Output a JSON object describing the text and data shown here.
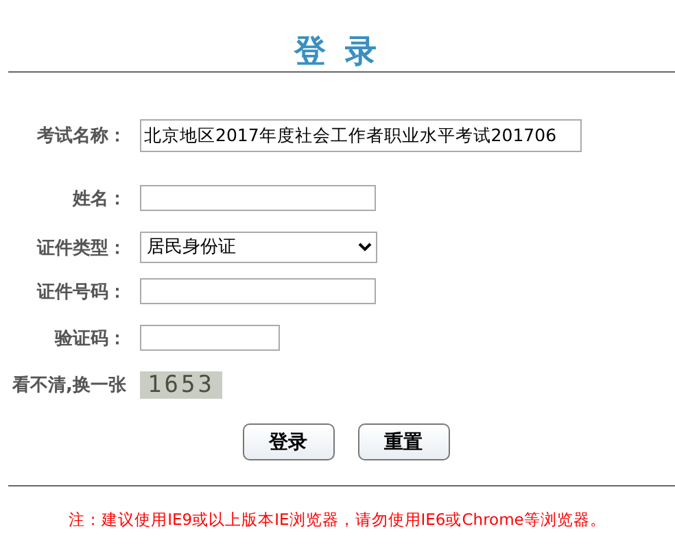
{
  "title": "登 录",
  "fields": [
    {
      "label": "考试名称：",
      "kind": "wide",
      "value": "北京地区2017年度社会工作者职业水平考试201706"
    },
    {
      "label": "姓名：",
      "kind": "text"
    },
    {
      "label": "证件类型：",
      "kind": "select",
      "value": "居民身份证"
    },
    {
      "label": "证件号码：",
      "kind": "text"
    },
    {
      "label": "验证码：",
      "kind": "short"
    },
    {
      "label": "看不清,换一张",
      "kind": "captcha",
      "value": "1653"
    }
  ],
  "buttons": [
    "登录",
    "重置"
  ],
  "note": "注：建议使用IE9或以上版本IE浏览器，请勿使用IE6或Chrome等浏览器。"
}
